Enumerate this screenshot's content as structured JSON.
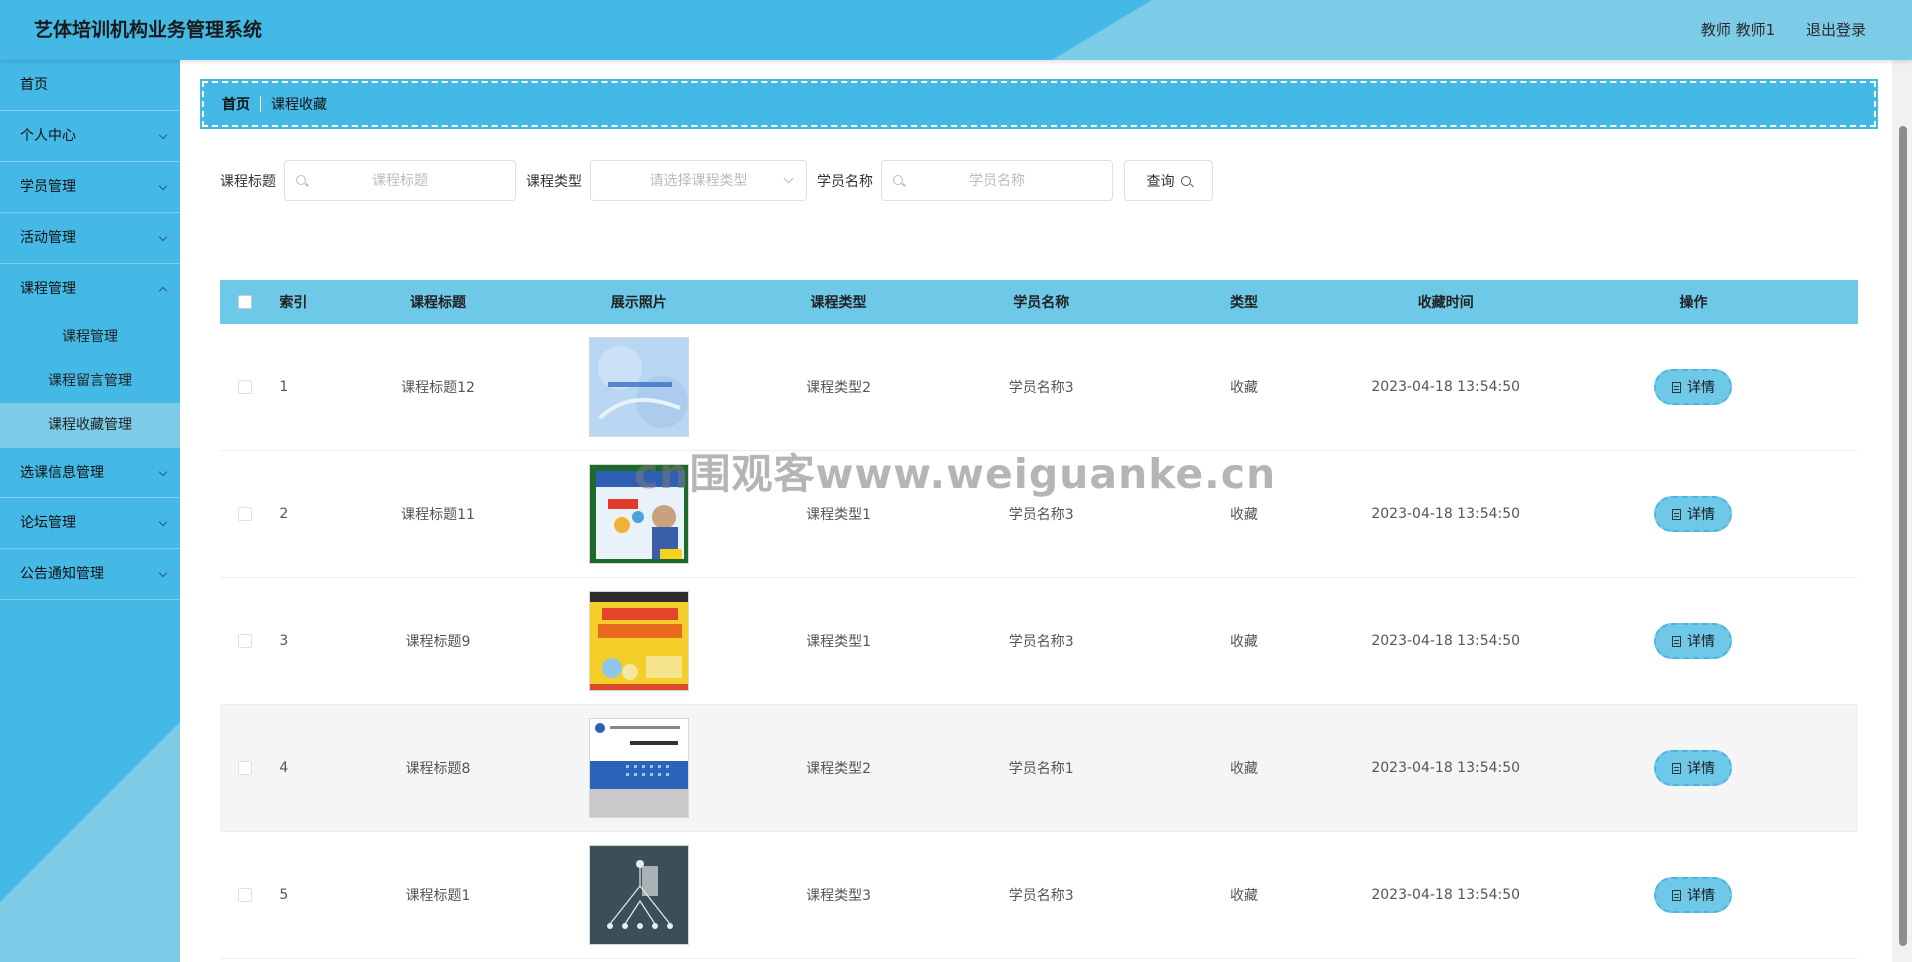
{
  "header": {
    "title": "艺体培训机构业务管理系统",
    "user": "教师 教师1",
    "logout": "退出登录"
  },
  "sidebar": {
    "items": [
      {
        "label": "首页"
      },
      {
        "label": "个人中心"
      },
      {
        "label": "学员管理"
      },
      {
        "label": "活动管理"
      },
      {
        "label": "课程管理",
        "children": [
          "课程管理",
          "课程留言管理",
          "课程收藏管理"
        ]
      },
      {
        "label": "选课信息管理"
      },
      {
        "label": "论坛管理"
      },
      {
        "label": "公告通知管理"
      }
    ]
  },
  "breadcrumb": {
    "home": "首页",
    "current": "课程收藏"
  },
  "search": {
    "title_label": "课程标题",
    "title_placeholder": "课程标题",
    "type_label": "课程类型",
    "type_placeholder": "请选择课程类型",
    "student_label": "学员名称",
    "student_placeholder": "学员名称",
    "query_button": "查询"
  },
  "table": {
    "headers": [
      "索引",
      "课程标题",
      "展示照片",
      "课程类型",
      "学员名称",
      "类型",
      "收藏时间",
      "操作"
    ],
    "rows": [
      {
        "index": "1",
        "title": "课程标题12",
        "photo": "network-basics-cover",
        "type": "课程类型2",
        "student": "学员名称3",
        "kind": "收藏",
        "time": "2023-04-18 13:54:50",
        "action": "详情"
      },
      {
        "index": "2",
        "title": "课程标题11",
        "photo": "presenter-cover",
        "type": "课程类型1",
        "student": "学员名称3",
        "kind": "收藏",
        "time": "2023-04-18 13:54:50",
        "action": "详情"
      },
      {
        "index": "3",
        "title": "课程标题9",
        "photo": "yellow-book-cover",
        "type": "课程类型1",
        "student": "学员名称3",
        "kind": "收藏",
        "time": "2023-04-18 13:54:50",
        "action": "详情"
      },
      {
        "index": "4",
        "title": "课程标题8",
        "photo": "blue-grid-book-cover",
        "type": "课程类型2",
        "student": "学员名称1",
        "kind": "收藏",
        "time": "2023-04-18 13:54:50",
        "action": "详情"
      },
      {
        "index": "5",
        "title": "课程标题1",
        "photo": "network-diagram-cover",
        "type": "课程类型3",
        "student": "学员名称3",
        "kind": "收藏",
        "time": "2023-04-18 13:54:50",
        "action": "详情"
      }
    ]
  },
  "watermark": "cn围观客www.weiguanke.cn",
  "colors": {
    "primary": "#45b9e6",
    "accent_light": "#7ccbe7",
    "table_header": "#6ec8e8"
  }
}
